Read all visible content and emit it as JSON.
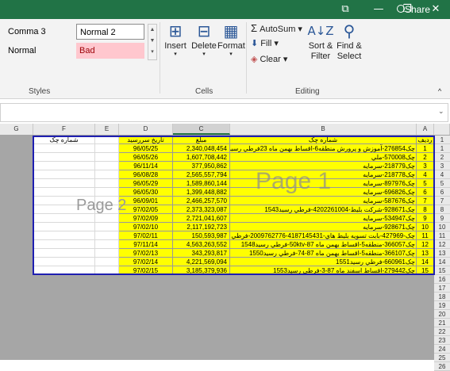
{
  "titlebar": {
    "icons": [
      "⧉",
      "—",
      "❐",
      "✕"
    ]
  },
  "ribbon": {
    "share_label": "Share",
    "styles": {
      "comma3": "Comma 3",
      "normal2": "Normal 2",
      "normal": "Normal",
      "bad": "Bad",
      "group_label": "Styles"
    },
    "cells": {
      "insert": "Insert",
      "delete": "Delete",
      "format": "Format",
      "group_label": "Cells"
    },
    "editing": {
      "autosum": "AutoSum",
      "fill": "Fill",
      "clear": "Clear",
      "sort_filter_1": "Sort &",
      "sort_filter_2": "Filter",
      "find_select_1": "Find &",
      "find_select_2": "Select",
      "group_label": "Editing"
    }
  },
  "sheet": {
    "columns": [
      "G",
      "F",
      "E",
      "D",
      "C",
      "B",
      "A"
    ],
    "headers": {
      "a": "ردیف",
      "b": "شماره چک",
      "c": "مبلغ",
      "d": "تاریخ سررسید",
      "f": "شماره چک"
    },
    "rows": [
      {
        "num": "1",
        "b": "چک276854-آموزش و پرورش منطقه6-اقساط بهمن ماه 23فرطي رسيد1540",
        "c": "2,340,048,454",
        "d": "96/05/25"
      },
      {
        "num": "2",
        "b": "چک570008-ملي",
        "c": "1,607,708,442",
        "d": "96/05/26"
      },
      {
        "num": "3",
        "b": "چک218779-سرمايه",
        "c": "377,950,862",
        "d": "96/11/14"
      },
      {
        "num": "4",
        "b": "چک218778-سرمايه",
        "c": "2,565,557,794",
        "d": "96/08/28"
      },
      {
        "num": "5",
        "b": "چک897976-سرمايه",
        "c": "1,589,860,144",
        "d": "96/05/29"
      },
      {
        "num": "6",
        "b": "چک696826-سرمايه",
        "c": "1,399,448,882",
        "d": "96/05/30"
      },
      {
        "num": "7",
        "b": "چک587676-سرمايه",
        "c": "2,466,257,570",
        "d": "96/09/01"
      },
      {
        "num": "8",
        "b": "چک928671-شرکت بليط-4202261004-فرطي رسيد1543",
        "c": "2,373,323,087",
        "d": "97/02/05"
      },
      {
        "num": "9",
        "b": "چک534947-سرمايه",
        "c": "2,721,041,607",
        "d": "97/02/09"
      },
      {
        "num": "10",
        "b": "چک928671-سرمايه",
        "c": "2,117,192,723",
        "d": "97/02/10"
      },
      {
        "num": "11",
        "b": "چک-427969-بابت تسويه بليط هاي-4187145431-2009762776-فرطي رسيد47",
        "c": "150,593,987",
        "d": "97/02/11"
      },
      {
        "num": "12",
        "b": "چک366057-منطقه5-اقساط بهمن ماه 87-50ktv-فرطي رسيد1548",
        "c": "4,563,263,552",
        "d": "97/11/14"
      },
      {
        "num": "13",
        "b": "چک366107-منطقه5-اقساط بهمن ماه 87-74-فرطي رسيد1550",
        "c": "343,293,817",
        "d": "97/02/13"
      },
      {
        "num": "14",
        "b": "چک660961-فرطي رسيد1551",
        "c": "4,221,569,094",
        "d": "97/02/14"
      },
      {
        "num": "15",
        "b": "چک279442-اقساط اسفند ماه 87-3-فرطي رسيد1553",
        "c": "3,185,379,936",
        "d": "97/02/15"
      }
    ],
    "extra_rows": [
      "16",
      "17",
      "18",
      "19",
      "20",
      "21",
      "22",
      "23",
      "24",
      "25",
      "26"
    ],
    "watermarks": {
      "page1": "Page 1",
      "page2": "Page 2"
    }
  }
}
